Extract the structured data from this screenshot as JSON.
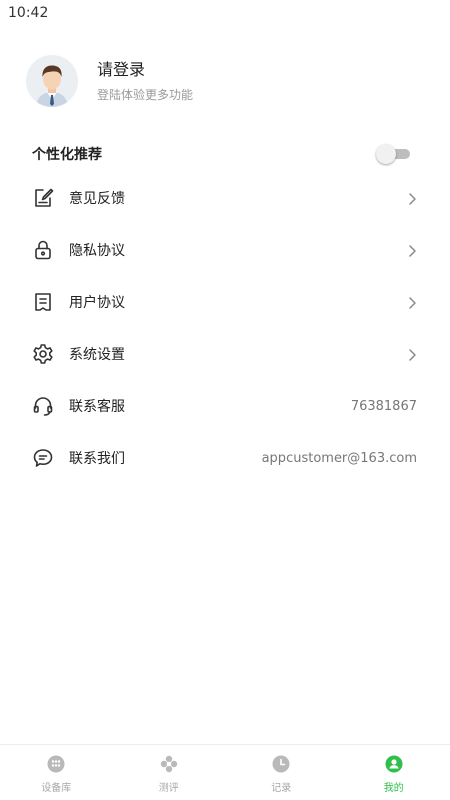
{
  "status_bar": {
    "time": "10:42"
  },
  "profile": {
    "title": "请登录",
    "subtitle": "登陆体验更多功能",
    "avatar_icon": "user-avatar-icon"
  },
  "personalized": {
    "label": "个性化推荐",
    "enabled": false
  },
  "menu": [
    {
      "label": "意见反馈",
      "icon": "feedback-edit-icon",
      "value": "",
      "chevron": true
    },
    {
      "label": "隐私协议",
      "icon": "lock-icon",
      "value": "",
      "chevron": true
    },
    {
      "label": "用户协议",
      "icon": "document-icon",
      "value": "",
      "chevron": true
    },
    {
      "label": "系统设置",
      "icon": "gear-icon",
      "value": "",
      "chevron": true
    },
    {
      "label": "联系客服",
      "icon": "headset-icon",
      "value": "76381867",
      "chevron": false
    },
    {
      "label": "联系我们",
      "icon": "chat-bubble-icon",
      "value": "appcustomer@163.com",
      "chevron": false
    }
  ],
  "tabbar": {
    "tabs": [
      {
        "label": "设备库",
        "icon": "grid-circle-icon",
        "active": false
      },
      {
        "label": "测评",
        "icon": "flower-icon",
        "active": false
      },
      {
        "label": "记录",
        "icon": "clock-icon",
        "active": false
      },
      {
        "label": "我的",
        "icon": "profile-icon",
        "active": true
      }
    ],
    "active_color": "#2fbf4a",
    "inactive_color": "#a7a7a7"
  }
}
